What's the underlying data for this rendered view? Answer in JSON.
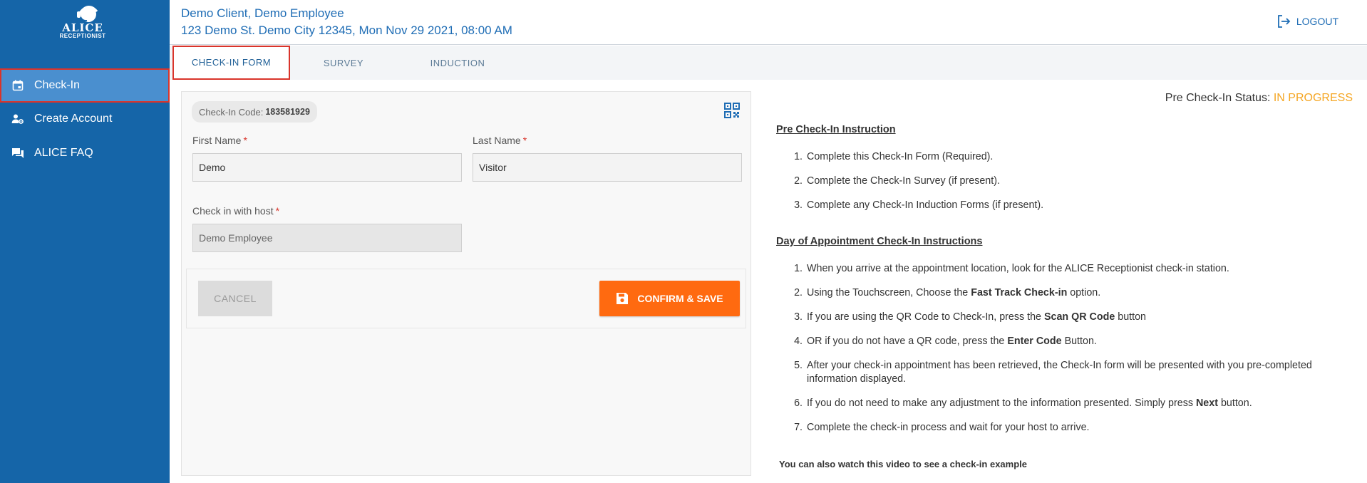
{
  "sidebar": {
    "logo_text": "ALICE",
    "logo_sub": "RECEPTIONIST",
    "items": [
      {
        "label": "Check-In",
        "icon": "calendar-icon",
        "active": true
      },
      {
        "label": "Create Account",
        "icon": "user-gear-icon",
        "active": false
      },
      {
        "label": "ALICE FAQ",
        "icon": "chat-icon",
        "active": false
      }
    ]
  },
  "header": {
    "line1": "Demo Client, Demo Employee",
    "line2": "123 Demo St. Demo City 12345, Mon Nov 29 2021, 08:00 AM",
    "logout_label": "LOGOUT"
  },
  "tabs": [
    {
      "label": "CHECK-IN FORM",
      "active": true
    },
    {
      "label": "SURVEY",
      "active": false
    },
    {
      "label": "INDUCTION",
      "active": false
    }
  ],
  "form": {
    "code_label": "Check-In Code:",
    "code_value": "183581929",
    "first_name_label": "First Name",
    "first_name_value": "Demo",
    "last_name_label": "Last Name",
    "last_name_value": "Visitor",
    "host_label": "Check in with host",
    "host_value": "Demo Employee",
    "required_mark": "*",
    "cancel_label": "CANCEL",
    "save_label": "CONFIRM & SAVE"
  },
  "status": {
    "label": "Pre Check-In Status:",
    "value": "IN PROGRESS",
    "value_color": "#f5a623"
  },
  "pre_instructions": {
    "title": "Pre Check-In Instruction",
    "items": [
      "Complete this Check-In Form (Required).",
      "Complete the Check-In Survey (if present).",
      "Complete any Check-In Induction Forms (if present)."
    ]
  },
  "day_instructions": {
    "title": "Day of Appointment Check-In Instructions",
    "items": [
      {
        "pre": "When you arrive at the appointment location, look for the ALICE Receptionist check-in station.",
        "bold": "",
        "post": ""
      },
      {
        "pre": "Using the Touchscreen, Choose the ",
        "bold": "Fast Track Check-in",
        "post": " option."
      },
      {
        "pre": "If you are using the QR Code to Check-In, press the ",
        "bold": "Scan QR Code",
        "post": " button"
      },
      {
        "pre": "OR if you do not have a QR code, press the ",
        "bold": "Enter Code",
        "post": " Button."
      },
      {
        "pre": "After your check-in appointment has been retrieved, the Check-In form will be presented with you pre-completed information displayed.",
        "bold": "",
        "post": ""
      },
      {
        "pre": "If you do not need to make any adjustment to the information presented. Simply press ",
        "bold": "Next",
        "post": " button."
      },
      {
        "pre": "Complete the check-in process and wait for your host to arrive.",
        "bold": "",
        "post": ""
      }
    ]
  },
  "video_note": "You can also watch this video to see a check-in example",
  "colors": {
    "sidebar": "#1565a8",
    "accent": "#1f6db5",
    "save_button": "#ff6a10"
  }
}
